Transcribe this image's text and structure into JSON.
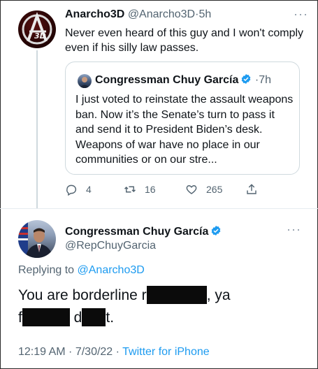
{
  "original_tweet": {
    "display_name": "Anarcho3D",
    "handle": "@Anarcho3D",
    "time": "5h",
    "text": "Never even heard of this guy and I won't comply even if his silly law passes.",
    "avatar_text": "3D"
  },
  "quoted_tweet": {
    "display_name": "Congressman Chuy García",
    "time": "7h",
    "text": "I just voted to reinstate the assault weapons ban. Now it’s the Senate’s turn to pass it and send it to President Biden’s desk. Weapons of war have no place in our communities or on our stre..."
  },
  "actions": {
    "replies": "4",
    "retweets": "16",
    "likes": "265"
  },
  "reply_tweet": {
    "display_name": "Congressman Chuy García",
    "handle": "@RepChuyGarcia",
    "replying_prefix": "Replying to",
    "replying_to": "@Anarcho3D",
    "text_part1": "You are borderline r",
    "text_part2": ", ya",
    "text_part3": "f",
    "text_part4": " d",
    "text_part5": "t.",
    "time": "12:19 AM · 7/30/22 ·",
    "source": "Twitter for iPhone"
  },
  "colors": {
    "accent": "#1d9bf0",
    "secondary_text": "#536471",
    "border": "#cfd9de"
  }
}
